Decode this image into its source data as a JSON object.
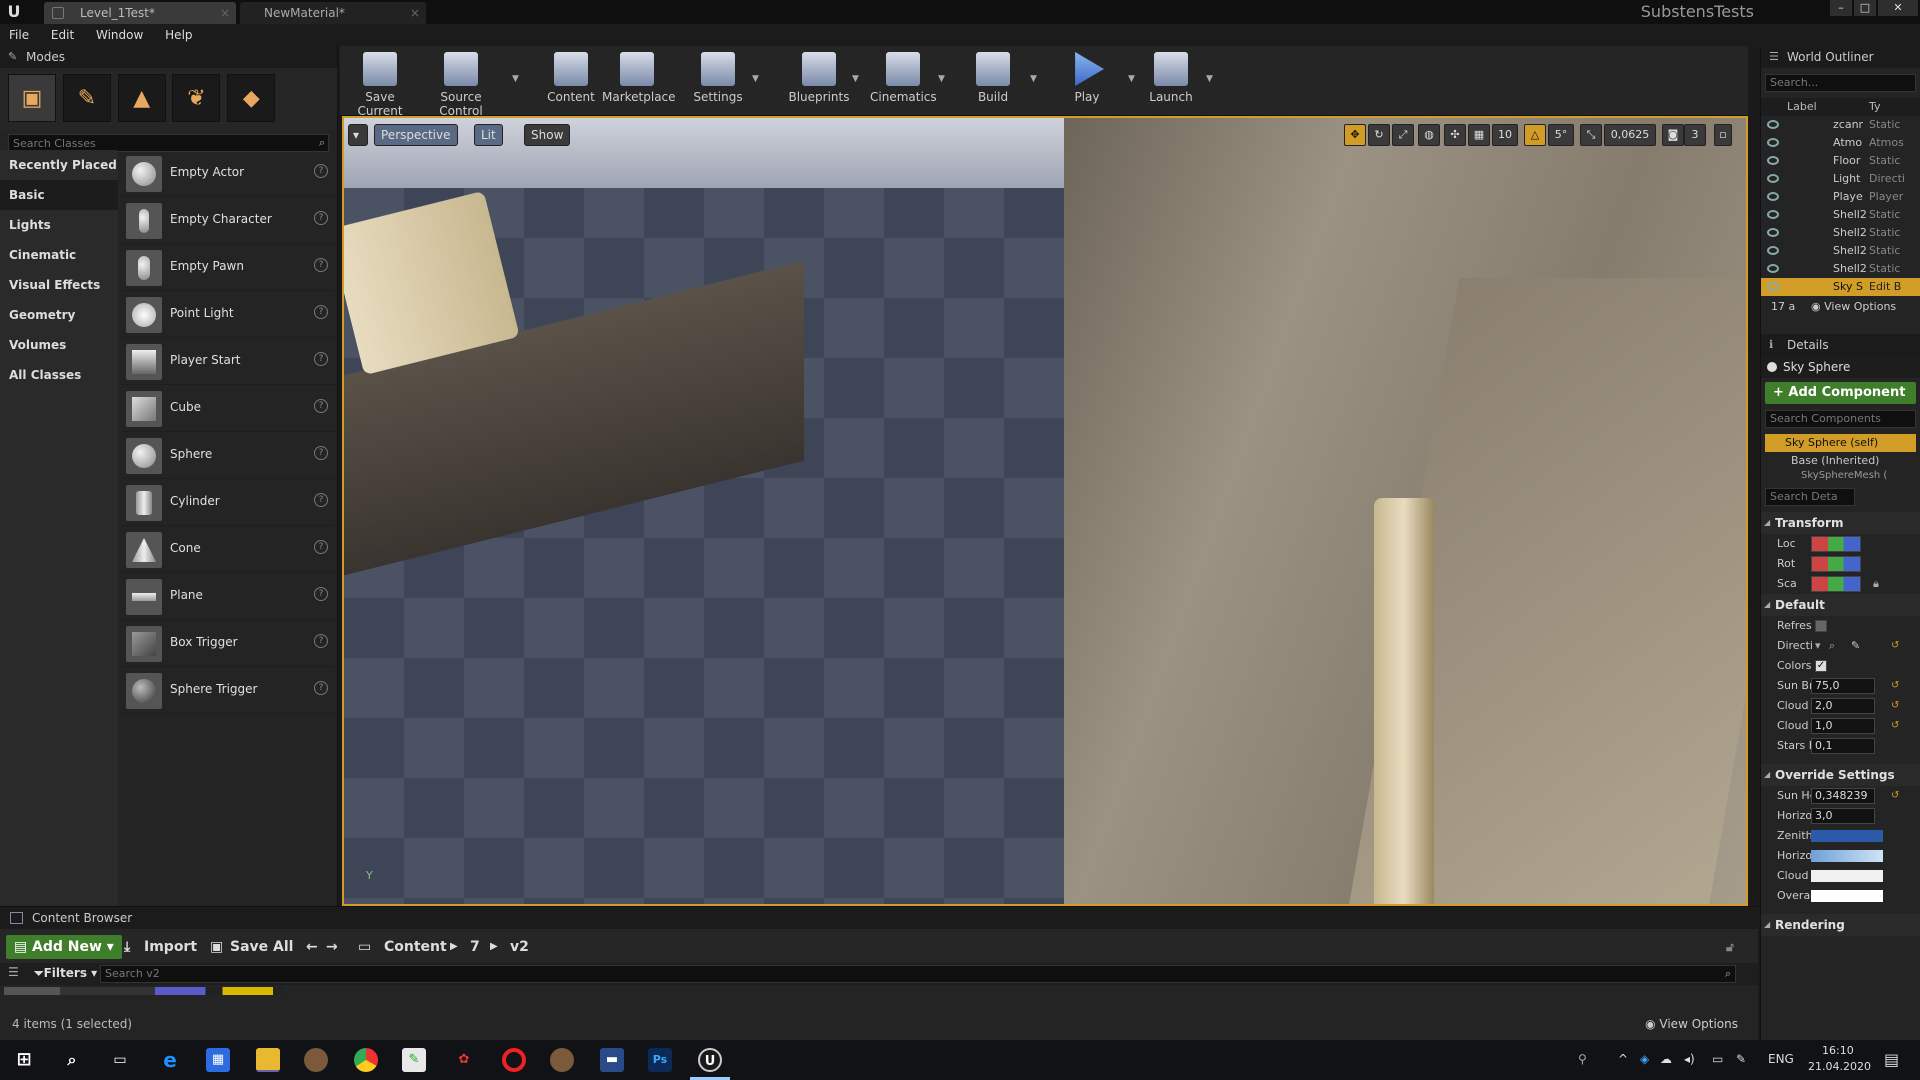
{
  "titlebar": {
    "tabs": [
      {
        "label": "Level_1Test*"
      },
      {
        "label": "NewMaterial*"
      }
    ],
    "project_name": "SubstensTests"
  },
  "menu": [
    "File",
    "Edit",
    "Window",
    "Help"
  ],
  "modes": {
    "header": "Modes",
    "search_placeholder": "Search Classes",
    "categories": [
      "Recently Placed",
      "Basic",
      "Lights",
      "Cinematic",
      "Visual Effects",
      "Geometry",
      "Volumes",
      "All Classes"
    ],
    "active_category": "Basic",
    "items": [
      "Empty Actor",
      "Empty Character",
      "Empty Pawn",
      "Point Light",
      "Player Start",
      "Cube",
      "Sphere",
      "Cylinder",
      "Cone",
      "Plane",
      "Box Trigger",
      "Sphere Trigger"
    ]
  },
  "toolbar": {
    "buttons": [
      {
        "label": "Save Current"
      },
      {
        "label": "Source Control"
      },
      {
        "label": "Content"
      },
      {
        "label": "Marketplace"
      },
      {
        "label": "Settings"
      },
      {
        "label": "Blueprints"
      },
      {
        "label": "Cinematics"
      },
      {
        "label": "Build"
      },
      {
        "label": "Play"
      },
      {
        "label": "Launch"
      }
    ]
  },
  "viewport": {
    "perspective_label": "Perspective",
    "lit_label": "Lit",
    "show_label": "Show",
    "grid_snap": "10",
    "rotation_snap": "5°",
    "scale_snap": "0,0625",
    "camera_speed": "3",
    "axis_label": "Y"
  },
  "outliner": {
    "header": "World Outliner",
    "search_placeholder": "Search...",
    "col_label": "Label",
    "col_type": "Ty",
    "rows": [
      {
        "label": "zcanr",
        "type": "Static"
      },
      {
        "label": "Atmo",
        "type": "Atmos"
      },
      {
        "label": "Floor",
        "type": "Static"
      },
      {
        "label": "Light",
        "type": "Directi"
      },
      {
        "label": "Playe",
        "type": "Player"
      },
      {
        "label": "Shell2",
        "type": "Static"
      },
      {
        "label": "Shell2",
        "type": "Static"
      },
      {
        "label": "Shell2",
        "type": "Static"
      },
      {
        "label": "Shell2",
        "type": "Static"
      },
      {
        "label": "Sky S",
        "type": "Edit B"
      }
    ],
    "count": "17 a",
    "view_options": "View Options"
  },
  "details": {
    "header": "Details",
    "selected_name": "Sky Sphere",
    "add_component": "+ Add Component",
    "search_components": "Search Components",
    "self_item": "Sky Sphere (self)",
    "base_item": "Base (Inherited)",
    "base_child": "SkySphereMesh (",
    "search_details": "Search Deta",
    "transform_section": "Transform",
    "transform_rows": [
      "Loc",
      "Rot",
      "Sca"
    ],
    "default_section": "Default",
    "default_rows": [
      {
        "label": "Refres",
        "kind": "check",
        "checked": false
      },
      {
        "label": "Directi",
        "kind": "dropdown"
      },
      {
        "label": "Colors",
        "kind": "check",
        "checked": true
      },
      {
        "label": "Sun Br",
        "kind": "number",
        "value": "75,0"
      },
      {
        "label": "Cloud S",
        "kind": "number",
        "value": "2,0"
      },
      {
        "label": "Cloud C",
        "kind": "number",
        "value": "1,0"
      },
      {
        "label": "Stars B",
        "kind": "number",
        "value": "0,1"
      }
    ],
    "override_section": "Override Settings",
    "override_rows": [
      {
        "label": "Sun He",
        "kind": "number",
        "value": "0,348239"
      },
      {
        "label": "Horizo",
        "kind": "number",
        "value": "3,0"
      },
      {
        "label": "Zenith",
        "kind": "color",
        "color": "#2a5aa8"
      },
      {
        "label": "Horizo",
        "kind": "color",
        "color": "#a8cde8"
      },
      {
        "label": "Cloud",
        "kind": "color",
        "color": "#f0f0f0"
      },
      {
        "label": "Overal",
        "kind": "color",
        "color": "#ffffff"
      }
    ],
    "rendering_section": "Rendering"
  },
  "content_browser": {
    "header": "Content Browser",
    "add_new": "Add New",
    "import": "Import",
    "save_all": "Save All",
    "breadcrumb": [
      "Content",
      "7",
      "v2"
    ],
    "filters": "Filters",
    "search_placeholder": "Search v2",
    "status": "4 items (1 selected)",
    "view_options": "View Options"
  },
  "taskbar": {
    "lang": "ENG",
    "time": "16:10",
    "date": "21.04.2020"
  },
  "colors": {
    "accent": "#d29d26",
    "green": "#3f7e2a"
  }
}
